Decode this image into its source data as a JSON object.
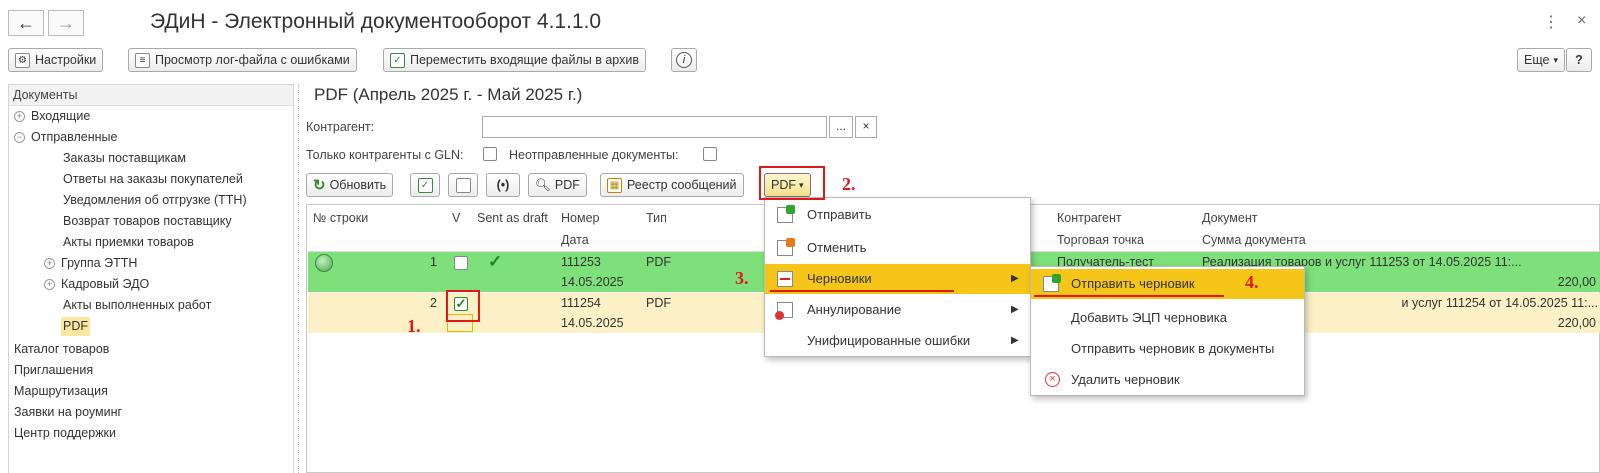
{
  "app": {
    "title": "ЭДиН - Электронный документооборот 4.1.1.0"
  },
  "window_controls": {
    "more_icon": "kebab-icon",
    "close_glyph": "×",
    "more_glyph": "⋮"
  },
  "toolbar": {
    "settings": "Настройки",
    "view_log": "Просмотр лог-файла с ошибками",
    "move_archive": "Переместить входящие файлы в архив",
    "more": "Еще",
    "help": "?"
  },
  "sidebar": {
    "header": "Документы",
    "items": [
      {
        "label": "Входящие"
      },
      {
        "label": "Отправленные"
      },
      {
        "label": "Заказы поставщикам"
      },
      {
        "label": "Ответы на заказы покупателей"
      },
      {
        "label": "Уведомления об отгрузке (ТТН)"
      },
      {
        "label": "Возврат товаров поставщику"
      },
      {
        "label": "Акты приемки товаров"
      },
      {
        "label": "Группа ЭТТН"
      },
      {
        "label": "Кадровый ЭДО"
      },
      {
        "label": "Акты выполненных работ"
      },
      {
        "label": "PDF"
      },
      {
        "label": "Каталог товаров"
      },
      {
        "label": "Приглашения"
      },
      {
        "label": "Маршрутизация"
      },
      {
        "label": "Заявки на роуминг"
      },
      {
        "label": "Центр поддержки"
      }
    ]
  },
  "form": {
    "title": "PDF (Апрель 2025 г. - Май 2025 г.)",
    "counterparty_label": "Контрагент:",
    "counterparty_value": "",
    "ellipsis": "...",
    "clear": "×",
    "gln_only_label": "Только контрагенты с GLN:",
    "unsent_label": "Неотправленные документы:",
    "refresh": "Обновить",
    "pdf_btn": "PDF",
    "registry": "Реестр сообщений",
    "pdf_dropdown": "PDF"
  },
  "grid": {
    "headers": {
      "row_no": "№ строки",
      "v": "V",
      "sent_as_draft": "Sent as draft",
      "number": "Номер",
      "date": "Дата",
      "type": "Тип",
      "counterparty": "Контрагент",
      "trade_point": "Торговая точка",
      "document": "Документ",
      "doc_sum": "Сумма документа"
    },
    "rows": [
      {
        "row_no": "1",
        "number": "111253",
        "date": "14.05.2025",
        "type": "PDF",
        "counterparty": "Получатель-тест",
        "document": "Реализация товаров и услуг 111253 от 14.05.2025 11:...",
        "sum": "220,00"
      },
      {
        "row_no": "2",
        "number": "111254",
        "date": "14.05.2025",
        "type": "PDF",
        "counterparty": "",
        "document": "и услуг 111254 от 14.05.2025 11:...",
        "sum": "220,00"
      }
    ]
  },
  "menu": {
    "items": [
      {
        "label": "Отправить"
      },
      {
        "label": "Отменить"
      },
      {
        "label": "Черновики"
      },
      {
        "label": "Аннулирование"
      },
      {
        "label": "Унифицированные ошибки"
      }
    ]
  },
  "submenu": {
    "items": [
      {
        "label": "Отправить черновик"
      },
      {
        "label": "Добавить ЭЦП черновика"
      },
      {
        "label": "Отправить черновик в документы"
      },
      {
        "label": "Удалить черновик"
      }
    ]
  },
  "annotations": {
    "s1": "1.",
    "s2": "2.",
    "s3": "3.",
    "s4": "4."
  },
  "colors": {
    "accent_highlight": "#f5c518",
    "sent_row": "#7ee07a",
    "selected_row": "#fcf1c6",
    "annotation_red": "#e01818"
  }
}
